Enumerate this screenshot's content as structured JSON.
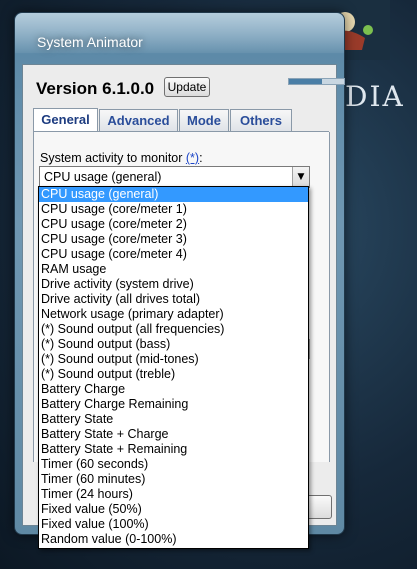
{
  "window": {
    "title": "System Animator"
  },
  "wallpaper": {
    "text": "DIA"
  },
  "header": {
    "version_label": "Version 6.1.0.0",
    "update_label": "Update",
    "progress_fraction": 0.6
  },
  "tabs": [
    {
      "label": "General",
      "active": true
    },
    {
      "label": "Advanced",
      "active": false
    },
    {
      "label": "Mode",
      "active": false
    },
    {
      "label": "Others",
      "active": false
    }
  ],
  "general": {
    "activity_label": "System activity to monitor",
    "activity_link": "(*)",
    "activity_suffix": ":",
    "combo_value": "CPU usage (general)",
    "combo_arrow": "▼"
  },
  "dropdown": {
    "options": [
      "CPU usage (general)",
      "CPU usage (core/meter 1)",
      "CPU usage (core/meter 2)",
      "CPU usage (core/meter 3)",
      "CPU usage (core/meter 4)",
      "RAM usage",
      "Drive activity (system drive)",
      "Drive activity (all drives total)",
      "Network usage (primary adapter)",
      "(*) Sound output (all frequencies)",
      "(*) Sound output (bass)",
      "(*) Sound output (mid-tones)",
      "(*) Sound output (treble)",
      "Battery Charge",
      "Battery Charge Remaining",
      "Battery State",
      "Battery State + Charge",
      "Battery State + Remaining",
      "Timer (60 seconds)",
      "Timer (60 minutes)",
      "Timer (24 hours)",
      "Fixed value (50%)",
      "Fixed value (100%)",
      "Random value (0-100%)"
    ],
    "selected_index": 0
  },
  "colors": {
    "selection": "#3399ff",
    "link": "#1d46c8"
  }
}
